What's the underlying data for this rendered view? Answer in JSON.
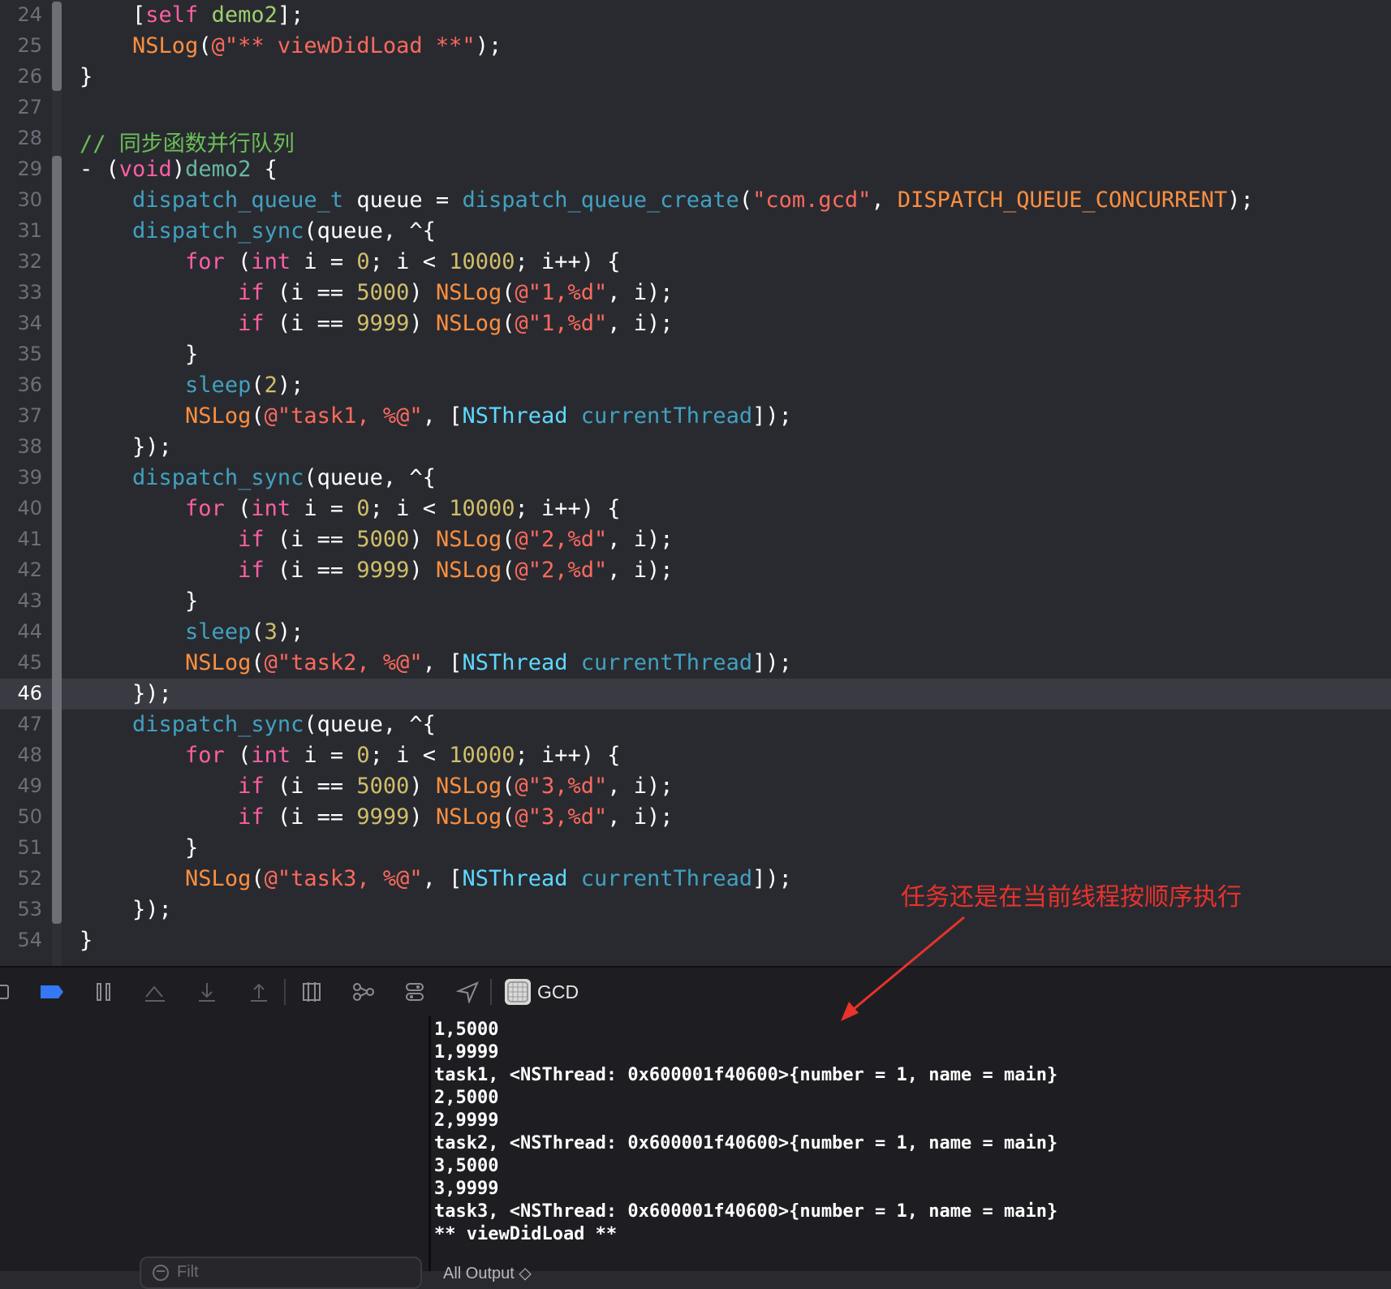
{
  "editor": {
    "current_line": 46,
    "lines": [
      {
        "n": "24",
        "tokens": [
          [
            "pl",
            "    ["
          ],
          [
            "kw",
            "self"
          ],
          [
            "pl",
            " "
          ],
          [
            "green",
            "demo2"
          ],
          [
            "pl",
            "];"
          ]
        ]
      },
      {
        "n": "25",
        "tokens": [
          [
            "pl",
            "    "
          ],
          [
            "macro",
            "NSLog"
          ],
          [
            "pl",
            "("
          ],
          [
            "str",
            "@\"** viewDidLoad **\""
          ],
          [
            "pl",
            ");"
          ]
        ]
      },
      {
        "n": "26",
        "tokens": [
          [
            "pl",
            "}"
          ]
        ]
      },
      {
        "n": "27",
        "tokens": []
      },
      {
        "n": "28",
        "tokens": [
          [
            "cmt",
            "// 同步函数并行队列"
          ]
        ]
      },
      {
        "n": "29",
        "tokens": [
          [
            "pl",
            "- ("
          ],
          [
            "kw",
            "void"
          ],
          [
            "pl",
            ")"
          ],
          [
            "id",
            "demo2"
          ],
          [
            "pl",
            " {"
          ]
        ]
      },
      {
        "n": "30",
        "tokens": [
          [
            "pl",
            "    "
          ],
          [
            "blue",
            "dispatch_queue_t"
          ],
          [
            "pl",
            " queue = "
          ],
          [
            "blue",
            "dispatch_queue_create"
          ],
          [
            "pl",
            "("
          ],
          [
            "str",
            "\"com.gcd\""
          ],
          [
            "pl",
            ", "
          ],
          [
            "macro",
            "DISPATCH_QUEUE_CONCURRENT"
          ],
          [
            "pl",
            ");"
          ]
        ]
      },
      {
        "n": "31",
        "tokens": [
          [
            "pl",
            "    "
          ],
          [
            "blue",
            "dispatch_sync"
          ],
          [
            "pl",
            "(queue, ^{"
          ]
        ]
      },
      {
        "n": "32",
        "tokens": [
          [
            "pl",
            "        "
          ],
          [
            "kw",
            "for"
          ],
          [
            "pl",
            " ("
          ],
          [
            "kw",
            "int"
          ],
          [
            "pl",
            " i = "
          ],
          [
            "num",
            "0"
          ],
          [
            "pl",
            "; i < "
          ],
          [
            "num",
            "10000"
          ],
          [
            "pl",
            "; i++) {"
          ]
        ]
      },
      {
        "n": "33",
        "tokens": [
          [
            "pl",
            "            "
          ],
          [
            "kw",
            "if"
          ],
          [
            "pl",
            " (i == "
          ],
          [
            "num",
            "5000"
          ],
          [
            "pl",
            ") "
          ],
          [
            "macro",
            "NSLog"
          ],
          [
            "pl",
            "("
          ],
          [
            "str",
            "@\"1,%d\""
          ],
          [
            "pl",
            ", i);"
          ]
        ]
      },
      {
        "n": "34",
        "tokens": [
          [
            "pl",
            "            "
          ],
          [
            "kw",
            "if"
          ],
          [
            "pl",
            " (i == "
          ],
          [
            "num",
            "9999"
          ],
          [
            "pl",
            ") "
          ],
          [
            "macro",
            "NSLog"
          ],
          [
            "pl",
            "("
          ],
          [
            "str",
            "@\"1,%d\""
          ],
          [
            "pl",
            ", i);"
          ]
        ]
      },
      {
        "n": "35",
        "tokens": [
          [
            "pl",
            "        }"
          ]
        ]
      },
      {
        "n": "36",
        "tokens": [
          [
            "pl",
            "        "
          ],
          [
            "blue",
            "sleep"
          ],
          [
            "pl",
            "("
          ],
          [
            "num",
            "2"
          ],
          [
            "pl",
            ");"
          ]
        ]
      },
      {
        "n": "37",
        "tokens": [
          [
            "pl",
            "        "
          ],
          [
            "macro",
            "NSLog"
          ],
          [
            "pl",
            "("
          ],
          [
            "str",
            "@\"task1, %@\""
          ],
          [
            "pl",
            ", ["
          ],
          [
            "type",
            "NSThread"
          ],
          [
            "pl",
            " "
          ],
          [
            "blue",
            "currentThread"
          ],
          [
            "pl",
            "]);"
          ]
        ]
      },
      {
        "n": "38",
        "tokens": [
          [
            "pl",
            "    });"
          ]
        ]
      },
      {
        "n": "39",
        "tokens": [
          [
            "pl",
            "    "
          ],
          [
            "blue",
            "dispatch_sync"
          ],
          [
            "pl",
            "(queue, ^{"
          ]
        ]
      },
      {
        "n": "40",
        "tokens": [
          [
            "pl",
            "        "
          ],
          [
            "kw",
            "for"
          ],
          [
            "pl",
            " ("
          ],
          [
            "kw",
            "int"
          ],
          [
            "pl",
            " i = "
          ],
          [
            "num",
            "0"
          ],
          [
            "pl",
            "; i < "
          ],
          [
            "num",
            "10000"
          ],
          [
            "pl",
            "; i++) {"
          ]
        ]
      },
      {
        "n": "41",
        "tokens": [
          [
            "pl",
            "            "
          ],
          [
            "kw",
            "if"
          ],
          [
            "pl",
            " (i == "
          ],
          [
            "num",
            "5000"
          ],
          [
            "pl",
            ") "
          ],
          [
            "macro",
            "NSLog"
          ],
          [
            "pl",
            "("
          ],
          [
            "str",
            "@\"2,%d\""
          ],
          [
            "pl",
            ", i);"
          ]
        ]
      },
      {
        "n": "42",
        "tokens": [
          [
            "pl",
            "            "
          ],
          [
            "kw",
            "if"
          ],
          [
            "pl",
            " (i == "
          ],
          [
            "num",
            "9999"
          ],
          [
            "pl",
            ") "
          ],
          [
            "macro",
            "NSLog"
          ],
          [
            "pl",
            "("
          ],
          [
            "str",
            "@\"2,%d\""
          ],
          [
            "pl",
            ", i);"
          ]
        ]
      },
      {
        "n": "43",
        "tokens": [
          [
            "pl",
            "        }"
          ]
        ]
      },
      {
        "n": "44",
        "tokens": [
          [
            "pl",
            "        "
          ],
          [
            "blue",
            "sleep"
          ],
          [
            "pl",
            "("
          ],
          [
            "num",
            "3"
          ],
          [
            "pl",
            ");"
          ]
        ]
      },
      {
        "n": "45",
        "tokens": [
          [
            "pl",
            "        "
          ],
          [
            "macro",
            "NSLog"
          ],
          [
            "pl",
            "("
          ],
          [
            "str",
            "@\"task2, %@\""
          ],
          [
            "pl",
            ", ["
          ],
          [
            "type",
            "NSThread"
          ],
          [
            "pl",
            " "
          ],
          [
            "blue",
            "currentThread"
          ],
          [
            "pl",
            "]);"
          ]
        ]
      },
      {
        "n": "46",
        "tokens": [
          [
            "pl",
            "    });"
          ]
        ]
      },
      {
        "n": "47",
        "tokens": [
          [
            "pl",
            "    "
          ],
          [
            "blue",
            "dispatch_sync"
          ],
          [
            "pl",
            "(queue, ^{"
          ]
        ]
      },
      {
        "n": "48",
        "tokens": [
          [
            "pl",
            "        "
          ],
          [
            "kw",
            "for"
          ],
          [
            "pl",
            " ("
          ],
          [
            "kw",
            "int"
          ],
          [
            "pl",
            " i = "
          ],
          [
            "num",
            "0"
          ],
          [
            "pl",
            "; i < "
          ],
          [
            "num",
            "10000"
          ],
          [
            "pl",
            "; i++) {"
          ]
        ]
      },
      {
        "n": "49",
        "tokens": [
          [
            "pl",
            "            "
          ],
          [
            "kw",
            "if"
          ],
          [
            "pl",
            " (i == "
          ],
          [
            "num",
            "5000"
          ],
          [
            "pl",
            ") "
          ],
          [
            "macro",
            "NSLog"
          ],
          [
            "pl",
            "("
          ],
          [
            "str",
            "@\"3,%d\""
          ],
          [
            "pl",
            ", i);"
          ]
        ]
      },
      {
        "n": "50",
        "tokens": [
          [
            "pl",
            "            "
          ],
          [
            "kw",
            "if"
          ],
          [
            "pl",
            " (i == "
          ],
          [
            "num",
            "9999"
          ],
          [
            "pl",
            ") "
          ],
          [
            "macro",
            "NSLog"
          ],
          [
            "pl",
            "("
          ],
          [
            "str",
            "@\"3,%d\""
          ],
          [
            "pl",
            ", i);"
          ]
        ]
      },
      {
        "n": "51",
        "tokens": [
          [
            "pl",
            "        }"
          ]
        ]
      },
      {
        "n": "52",
        "tokens": [
          [
            "pl",
            "        "
          ],
          [
            "macro",
            "NSLog"
          ],
          [
            "pl",
            "("
          ],
          [
            "str",
            "@\"task3, %@\""
          ],
          [
            "pl",
            ", ["
          ],
          [
            "type",
            "NSThread"
          ],
          [
            "pl",
            " "
          ],
          [
            "blue",
            "currentThread"
          ],
          [
            "pl",
            "]);"
          ]
        ]
      },
      {
        "n": "53",
        "tokens": [
          [
            "pl",
            "    });"
          ]
        ]
      },
      {
        "n": "54",
        "tokens": [
          [
            "pl",
            "}"
          ]
        ]
      }
    ]
  },
  "toolbar": {
    "scheme_label": "GCD"
  },
  "console": {
    "lines": [
      "1,5000",
      "1,9999",
      "task1, <NSThread: 0x600001f40600>{number = 1, name = main}",
      "2,5000",
      "2,9999",
      "task2, <NSThread: 0x600001f40600>{number = 1, name = main}",
      "3,5000",
      "3,9999",
      "task3, <NSThread: 0x600001f40600>{number = 1, name = main}",
      "** viewDidLoad **"
    ],
    "filter_placeholder": "Filt",
    "output_selector": "All Output ◇"
  },
  "annotation": {
    "text": "任务还是在当前线程按顺序执行",
    "color": "#e8322b"
  },
  "colors": {
    "editor_bg": "#292a30",
    "console_bg": "#1e1e22",
    "accent": "#3478f6"
  }
}
